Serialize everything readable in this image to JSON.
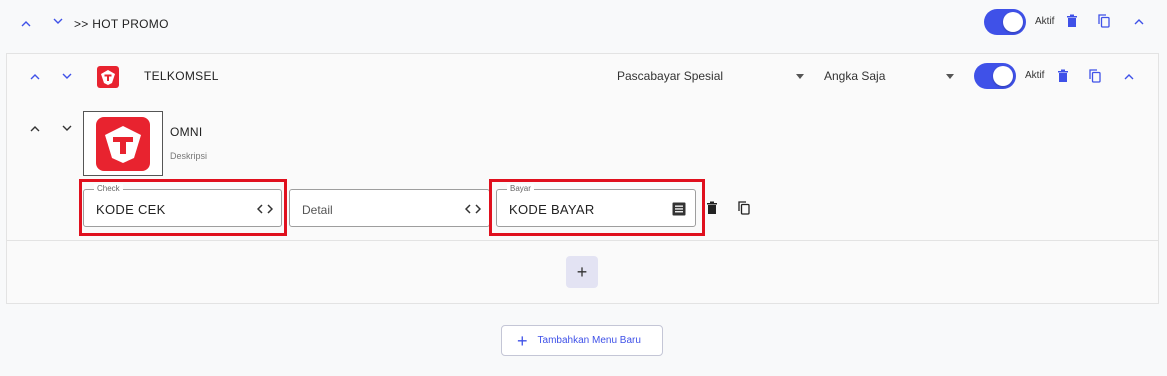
{
  "header": {
    "title": ">> HOT PROMO",
    "toggle_label": "Aktif"
  },
  "provider": {
    "name": "TELKOMSEL",
    "category_select": "Pascabayar Spesial",
    "input_type_select": "Angka Saja",
    "toggle_label": "Aktif"
  },
  "product": {
    "name": "OMNI",
    "description": "Deskripsi",
    "check_field": {
      "legend": "Check",
      "value": "KODE CEK"
    },
    "detail_field": {
      "placeholder": "Detail"
    },
    "pay_field": {
      "legend": "Bayar",
      "value": "KODE BAYAR"
    }
  },
  "add_menu_label": "Tambahkan Menu Baru",
  "colors": {
    "accent": "#3f51e8",
    "highlight": "#e0101e",
    "brand_red": "#e8232f"
  },
  "icons": [
    "chevron-up-icon",
    "chevron-down-icon",
    "trash-icon",
    "copy-icon",
    "code-icon",
    "list-icon",
    "plus-icon",
    "telkomsel-logo"
  ]
}
